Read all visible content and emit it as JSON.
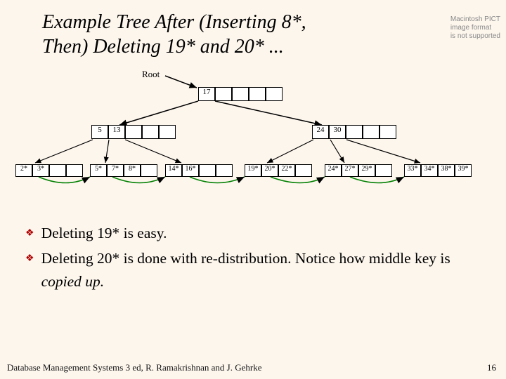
{
  "title_l1": "Example Tree After (Inserting 8*,",
  "title_l2": "Then) Deleting 19* and 20* ...",
  "pict": {
    "l1": "Macintosh PICT",
    "l2": "image format",
    "l3": "is not supported"
  },
  "tree": {
    "root_label": "Root",
    "root": [
      "17",
      "",
      "",
      "",
      ""
    ],
    "innerL": [
      "5",
      "13",
      "",
      "",
      ""
    ],
    "innerR": [
      "24",
      "30",
      "",
      "",
      ""
    ],
    "leaves": {
      "a": [
        "2*",
        "3*",
        "",
        ""
      ],
      "b": [
        "5*",
        "7*",
        "8*",
        ""
      ],
      "c": [
        "14*",
        "16*",
        "",
        ""
      ],
      "d": [
        "19*",
        "20*",
        "22*",
        ""
      ],
      "e": [
        "24*",
        "27*",
        "29*",
        ""
      ],
      "f": [
        "33*",
        "34*",
        "38*",
        "39*"
      ]
    }
  },
  "bul1": "Deleting 19* is easy.",
  "bul2a": "Deleting 20* is done with re-distribution. Notice how middle key is ",
  "bul2b": "copied up.",
  "footer_left": "Database Management Systems 3 ed,  R. Ramakrishnan and J. Gehrke",
  "footer_right": "16",
  "chart_data": {
    "type": "tree",
    "title": "B+ tree after inserting 8* then deleting 19* and 20*",
    "root": {
      "keys": [
        17
      ]
    },
    "internal": [
      {
        "keys": [
          5,
          13
        ]
      },
      {
        "keys": [
          24,
          30
        ]
      }
    ],
    "leaves": [
      {
        "entries": [
          "2*",
          "3*"
        ]
      },
      {
        "entries": [
          "5*",
          "7*",
          "8*"
        ]
      },
      {
        "entries": [
          "14*",
          "16*"
        ]
      },
      {
        "entries": [
          "19*",
          "20*",
          "22*"
        ]
      },
      {
        "entries": [
          "24*",
          "27*",
          "29*"
        ]
      },
      {
        "entries": [
          "33*",
          "34*",
          "38*",
          "39*"
        ]
      }
    ]
  }
}
